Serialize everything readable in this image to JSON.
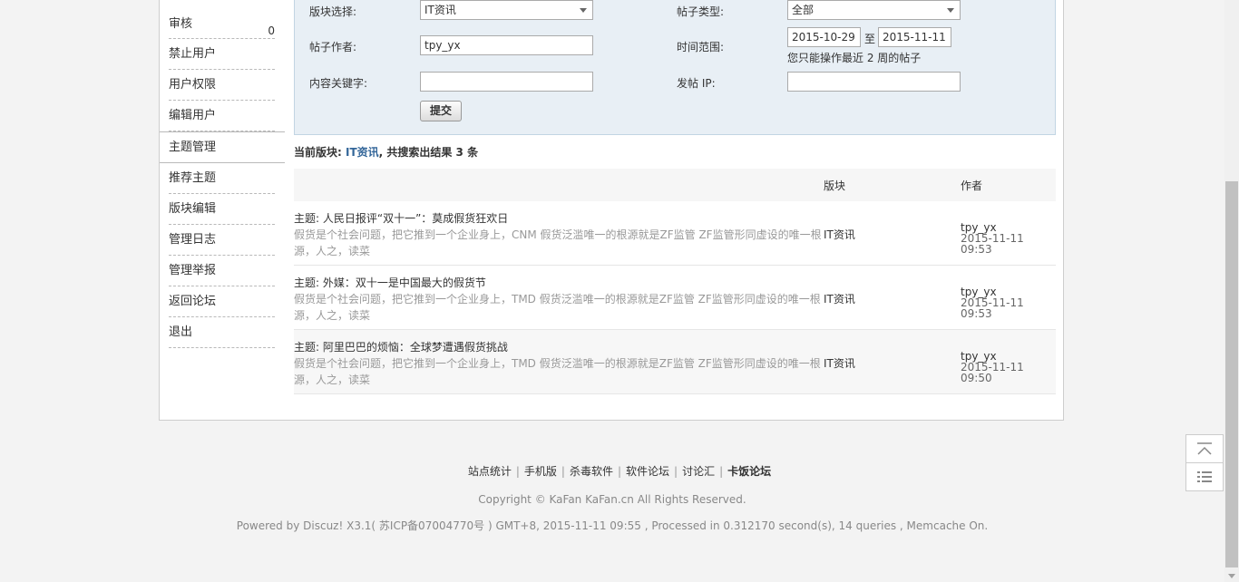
{
  "sidebar": {
    "items": [
      {
        "label": "审核",
        "count": "0"
      },
      {
        "label": "禁止用户"
      },
      {
        "label": "用户权限"
      },
      {
        "label": "编辑用户"
      },
      {
        "label": "主题管理"
      },
      {
        "label": "推荐主题"
      },
      {
        "label": "版块编辑"
      },
      {
        "label": "管理日志"
      },
      {
        "label": "管理举报"
      },
      {
        "label": "返回论坛"
      },
      {
        "label": "退出"
      }
    ]
  },
  "search": {
    "forum_label": "版块选择:",
    "forum_value": "IT资讯",
    "type_label": "帖子类型:",
    "type_value": "全部",
    "author_label": "帖子作者:",
    "author_value": "tpy_yx",
    "time_label": "时间范围:",
    "date_from": "2015-10-29",
    "date_sep": "至",
    "date_to": "2015-11-11",
    "time_hint": "您只能操作最近 2 周的帖子",
    "keyword_label": "内容关键字:",
    "keyword_value": "",
    "ip_label": "发帖 IP:",
    "ip_value": "",
    "submit_label": "提交"
  },
  "summary": {
    "prefix": "当前版块: ",
    "forum": "IT资讯",
    "suffix": ", 共搜索出结果 3 条"
  },
  "table": {
    "col_forum": "版块",
    "col_author": "作者",
    "rows": [
      {
        "subject": "主题: 人民日报评“双十一”：莫成假货狂欢日",
        "content": "假货是个社会问题，把它推到一个企业身上，CNM 假货泛滥唯一的根源就是ZF监管 ZF监管形同虚设的唯一根源，人之，读菜",
        "forum": "IT资讯",
        "author": "tpy_yx",
        "time": "2015-11-11 09:53"
      },
      {
        "subject": "主题: 外媒：双十一是中国最大的假货节",
        "content": "假货是个社会问题，把它推到一个企业身上，TMD 假货泛滥唯一的根源就是ZF监管 ZF监管形同虚设的唯一根源，人之，读菜",
        "forum": "IT资讯",
        "author": "tpy_yx",
        "time": "2015-11-11 09:53"
      },
      {
        "subject": "主题: 阿里巴巴的烦恼：全球梦遭遇假货挑战",
        "content": "假货是个社会问题，把它推到一个企业身上，TMD 假货泛滥唯一的根源就是ZF监管 ZF监管形同虚设的唯一根源，人之，读菜",
        "forum": "IT资讯",
        "author": "tpy_yx",
        "time": "2015-11-11 09:50"
      }
    ]
  },
  "footer": {
    "links": [
      "站点统计",
      "手机版",
      "杀毒软件",
      "软件论坛",
      "讨论汇"
    ],
    "brand": "卡饭论坛",
    "copyright": "Copyright © KaFan  KaFan.cn All Rights Reserved.",
    "powered": "Powered by Discuz! X3.1( 苏ICP备07004770号 ) GMT+8, 2015-11-11 09:55 , Processed in 0.312170 second(s), 14 queries , Memcache On."
  },
  "float_tools": {
    "top_icon": "back-to-top-icon",
    "list_icon": "list-icon"
  }
}
